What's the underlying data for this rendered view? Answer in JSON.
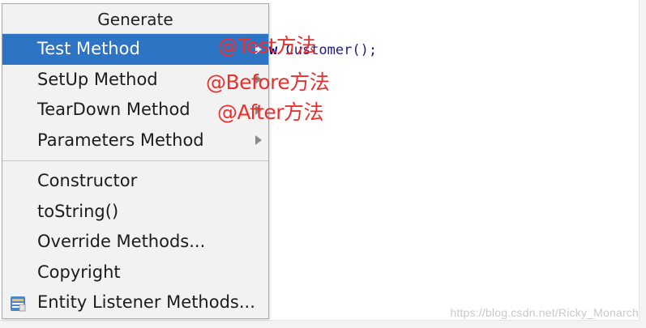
{
  "editor": {
    "code_keyword": "w",
    "code_text": " Customer();"
  },
  "menu": {
    "header": "Generate",
    "group1": [
      {
        "label": "Test Method",
        "has_submenu": true,
        "selected": true
      },
      {
        "label": "SetUp Method",
        "has_submenu": true,
        "selected": false
      },
      {
        "label": "TearDown Method",
        "has_submenu": true,
        "selected": false
      },
      {
        "label": "Parameters Method",
        "has_submenu": true,
        "selected": false
      }
    ],
    "group2": [
      {
        "label": "Constructor"
      },
      {
        "label": "toString()"
      },
      {
        "label": "Override Methods..."
      },
      {
        "label": "Copyright"
      },
      {
        "label": "Entity Listener Methods...",
        "icon": "entity-listener-icon"
      }
    ]
  },
  "annotations": {
    "test": "@Test方法",
    "before": "@Before方法",
    "after": "@After方法"
  },
  "watermark": "https://blog.csdn.net/Ricky_Monarch",
  "colors": {
    "selection": "#2e74c4",
    "annotation": "#e8312f"
  }
}
